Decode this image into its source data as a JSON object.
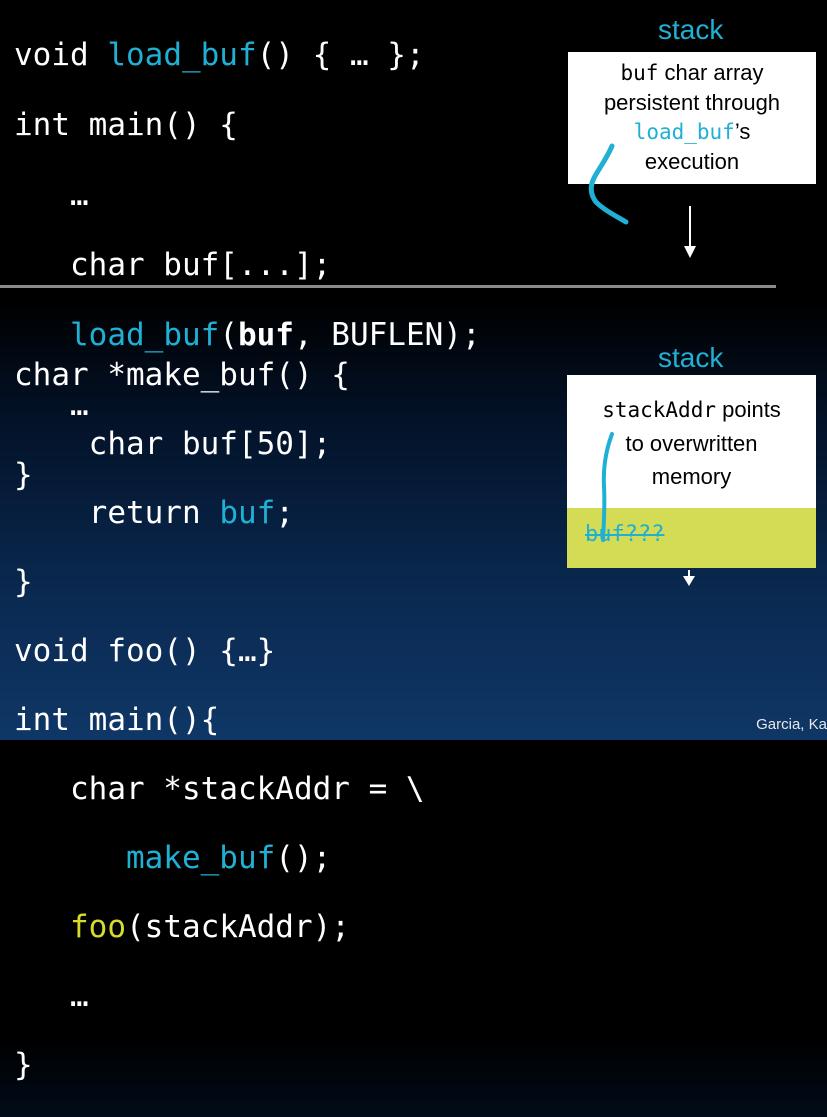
{
  "top_code": {
    "l1_kw": "void ",
    "l1_fn": "load_buf",
    "l1_rest": "() { … };",
    "l2": "int main() {",
    "l3": "   …",
    "l4": "   char buf[...];",
    "l5_fn": "load_buf",
    "l5_open": "(",
    "l5_arg": "buf",
    "l5_rest": ", BUFLEN);",
    "l6": "   …",
    "l7": "}"
  },
  "bottom_code": {
    "l1": "char *make_buf() {",
    "l2": "    char buf[50];",
    "l3_kw": "    return ",
    "l3_var": "buf",
    "l3_end": ";",
    "l4": "}",
    "l5": "void foo() {…}",
    "l6": "int main(){",
    "l7": "   char *stackAddr = \\",
    "l8_fn": "make_buf",
    "l8_rest": "();",
    "l9_fn": "foo",
    "l9_rest": "(stackAddr);",
    "l10": "   …",
    "l11": "}"
  },
  "top_stack": {
    "label": "stack",
    "line1_mono": "buf",
    "line1_rest": " char array",
    "line2": "persistent through",
    "line3_fn": "load_buf",
    "line3_rest": "’s",
    "line4": "execution"
  },
  "bottom_stack": {
    "label": "stack",
    "line1_mono": "stackAddr",
    "line1_rest": " points",
    "line2": "to overwritten",
    "line3": "memory",
    "buf_label": "buf???"
  },
  "credit": "Garcia, Ka",
  "colors": {
    "accent_cyan": "#1fb0d4",
    "accent_yellow": "#d6dc2e",
    "buf_region": "#d4dc55"
  }
}
